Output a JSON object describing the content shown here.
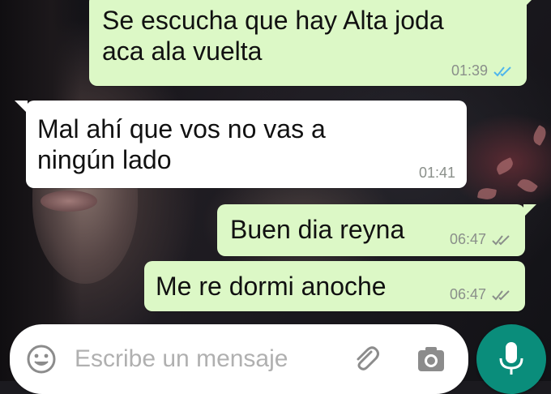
{
  "messages": [
    {
      "direction": "outgoing",
      "text": "Se escucha que hay Alta joda\naca ala vuelta",
      "time": "01:39",
      "status": "read"
    },
    {
      "direction": "incoming",
      "text": "Mal ahí que vos no vas a\nningún lado",
      "time": "01:41"
    },
    {
      "direction": "outgoing",
      "text": "Buen dia reyna",
      "time": "06:47",
      "status": "delivered"
    },
    {
      "direction": "outgoing",
      "text": "Me re dormi anoche",
      "time": "06:47",
      "status": "delivered"
    }
  ],
  "composer": {
    "placeholder": "Escribe un mensaje",
    "emoji_icon": "emoji-icon",
    "attach_icon": "paperclip-icon",
    "camera_icon": "camera-icon",
    "mic_icon": "microphone-icon"
  },
  "colors": {
    "outgoing_bubble": "#dcf8c6",
    "incoming_bubble": "#ffffff",
    "read_ticks": "#4fb6ec",
    "delivered_ticks": "#8a8f8a",
    "mic_button": "#0a8d7b"
  }
}
